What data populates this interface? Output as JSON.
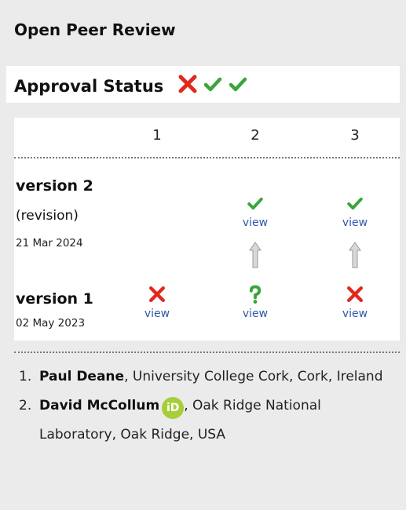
{
  "title": "Open Peer Review",
  "approval": {
    "label": "Approval Status",
    "icons": [
      "cross-icon",
      "check-icon",
      "check-icon"
    ]
  },
  "table": {
    "columns": [
      "1",
      "2",
      "3"
    ],
    "version2": {
      "label": "version 2",
      "revision": "(revision)",
      "date": "21 Mar 2024",
      "cells": [
        {
          "col": 1,
          "status": "none"
        },
        {
          "col": 2,
          "status": "approved",
          "link": "view"
        },
        {
          "col": 3,
          "status": "approved",
          "link": "view"
        }
      ]
    },
    "version1": {
      "label": "version 1",
      "date": "02 May 2023",
      "cells": [
        {
          "col": 1,
          "status": "not-approved",
          "link": "view"
        },
        {
          "col": 2,
          "status": "approved-with-reservations",
          "link": "view"
        },
        {
          "col": 3,
          "status": "not-approved",
          "link": "view"
        }
      ]
    }
  },
  "reviewers": [
    {
      "num": "1.",
      "name": "Paul Deane",
      "affiliation": ", University College Cork, Cork, Ireland"
    },
    {
      "num": "2.",
      "name": "David McCollum",
      "orcid": "iD",
      "affiliation": ", Oak Ridge National Laboratory, Oak Ridge, USA"
    }
  ],
  "colors": {
    "check": "#3aa53a",
    "cross": "#e0281e",
    "question": "#3aa53a",
    "link": "#2f5aa8",
    "orcid": "#a6ce39"
  }
}
